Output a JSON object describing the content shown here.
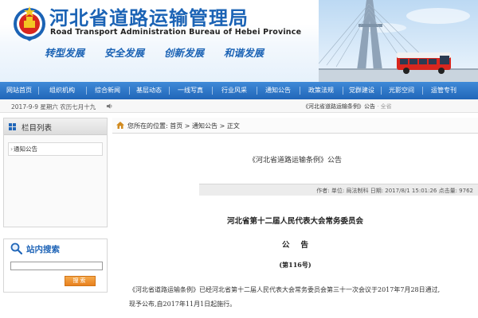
{
  "header": {
    "title": "河北省道路运输管理局",
    "subtitle": "Road Transport Administration Bureau of Hebei Province",
    "slogans": [
      "转型发展",
      "安全发展",
      "创新发展",
      "和谐发展"
    ],
    "emblem_icon": "road-transport-emblem",
    "colors": {
      "brand_blue": "#1b63b5",
      "emblem_red": "#d8261e",
      "bus_red": "#d8261e"
    }
  },
  "nav": {
    "items": [
      "网站首页",
      "组织机构",
      "综合新闻",
      "基层动态",
      "一线写真",
      "行业风采",
      "通知公告",
      "政策法规",
      "党群建设",
      "光影空间",
      "运管专刊"
    ]
  },
  "datebar": {
    "date": "2017-9-9  星期六  农历七月十九",
    "ticker": "《河北省道路运输条例》公告",
    "ticker_more": "· 全省"
  },
  "sidebar": {
    "column_title": "栏目列表",
    "items": [
      "通知公告"
    ],
    "search_title": "站内搜索",
    "search_placeholder": "",
    "search_button": "搜索"
  },
  "breadcrumb": {
    "text": "您所在的位置:  首页  >  通知公告  >  正文"
  },
  "article": {
    "title": "《河北省道路运输条例》公告",
    "meta": "作者:   单位: 局法制科   日期: 2017/8/1 15:01:26   点击量: 9762",
    "committee": "河北省第十二届人民代表大会常务委员会",
    "announce": "公告",
    "number": "(第116号)",
    "body_line1": "《河北省道路运输条例》已经河北省第十二届人民代表大会常务委员会第三十一次会议于2017年7月28日通过,",
    "body_line2": "现予公布,自2017年11月1日起施行。"
  }
}
